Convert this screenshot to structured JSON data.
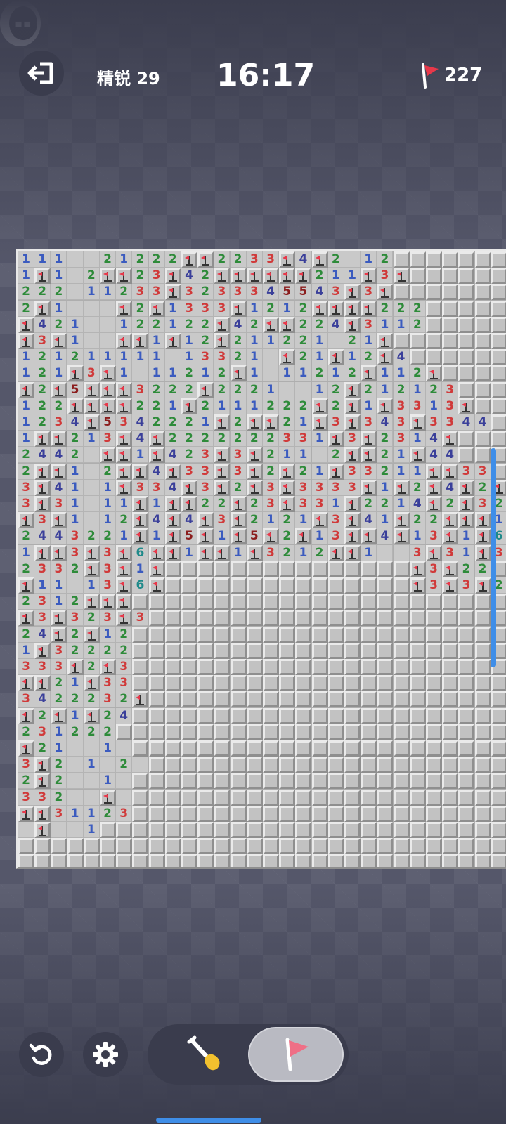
{
  "header": {
    "level_label": "精锐 29",
    "timer": "16:17",
    "flags_remaining": "227"
  },
  "icons": {
    "exit": "exit-icon",
    "flag": "flag-icon",
    "undo": "undo-icon",
    "settings": "gear-icon",
    "dig": "shovel-icon",
    "side": "chat-bubble-icon"
  },
  "colors": {
    "n1": "#3b5bbf",
    "n2": "#2e8b3a",
    "n3": "#d03a3a",
    "n4": "#3a3f9a",
    "n5": "#8b1d1d",
    "n6": "#1f8a8a",
    "flag": "#e8384a",
    "accent": "#3f8ee8"
  },
  "board": {
    "cols": 30,
    "rows": 38,
    "legend": "digits 1-8 = revealed number; 0 = revealed empty; F = flagged; . = covered",
    "cells": [
      "1110021222FF2233F4F2012.......",
      "1F102FF23F42FFFFFF211F3F......",
      "222011233F3233345543F3F.......",
      "2F1000F2F1333F1212FFFF222.....",
      "F42100122122F42FF224F3112.....",
      "F3F100FF1F12F211221021F.......",
      "1212111110133210F21F12F4......",
      "121F3F1011212F1011212F112F.....",
      "F2F5FFF3222F22210012F212123...",
      "122FFFF221F2111222F2F1F3313F..",
      "1234F5342221F2FF21F3F343F3344.",
      "1FF213F4F2222222331F3F2314F...",
      "24420FF1F423F3F21102FF21F44...",
      "2FF102FF4F33F3F2F21F33211FF33.",
      "3F4101F334F3F2F3F3333F1F2F4F2F2",
      "3F31011F1FF22F23F331F2214F2F3223",
      "F3F1012F4F4F3F2121F3F41F22FFF1FF2F2",
      "2443221F1F5F1F5F2F13FF4F13F1F6F3312",
      "1FF3F3F6FF1FF1F3212FF1003F31F3F1F01",
      "2332F3F1F...............F3F22..1",
      "F11013F6F...............F3F3F21F2",
      "2312FFF.......................",
      "F3F323F3......................",
      "24F2F12.......................",
      "1F32222.......................",
      "333F2F3.......................",
      "FF21F33.......................",
      "3422232F......................",
      "F2F1F24.......................",
      "231222........................",
      "F210010.......................",
      "3F201020......................",
      "2F20010.......................",
      "33200F0.......................",
      "FF31123.......................",
      "0F001.........................",
      "..............................",
      ".............................."
    ]
  }
}
